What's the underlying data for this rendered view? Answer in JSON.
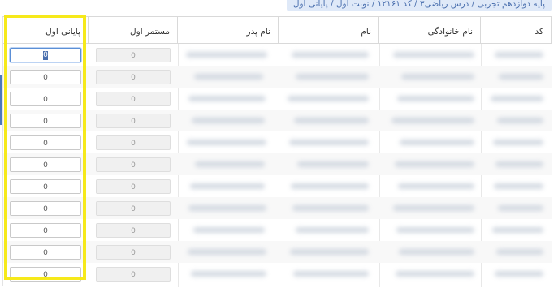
{
  "breadcrumb": "پایه دوازدهم تجربی / درس ریاضی۳ / کد ۱۲۱۶۱ / نوبت اول / پایانی اول",
  "table": {
    "headers": {
      "code": "کد",
      "last_name": "نام خانوادگی",
      "first_name": "نام",
      "father_name": "نام پدر",
      "continuous": "مستمر اول",
      "final": "پایانی اول"
    },
    "rows": [
      {
        "final": "0",
        "continuous": "0"
      },
      {
        "final": "0",
        "continuous": "0"
      },
      {
        "final": "0",
        "continuous": "0"
      },
      {
        "final": "0",
        "continuous": "0"
      },
      {
        "final": "0",
        "continuous": "0"
      },
      {
        "final": "0",
        "continuous": "0"
      },
      {
        "final": "0",
        "continuous": "0"
      },
      {
        "final": "0",
        "continuous": "0"
      },
      {
        "final": "0",
        "continuous": "0"
      },
      {
        "final": "0",
        "continuous": "0"
      },
      {
        "final": "0",
        "continuous": "0"
      }
    ]
  },
  "colors": {
    "highlight": "#f6e91a",
    "breadcrumb_bg": "#dfe9f8",
    "focus": "#5b8fd6"
  }
}
